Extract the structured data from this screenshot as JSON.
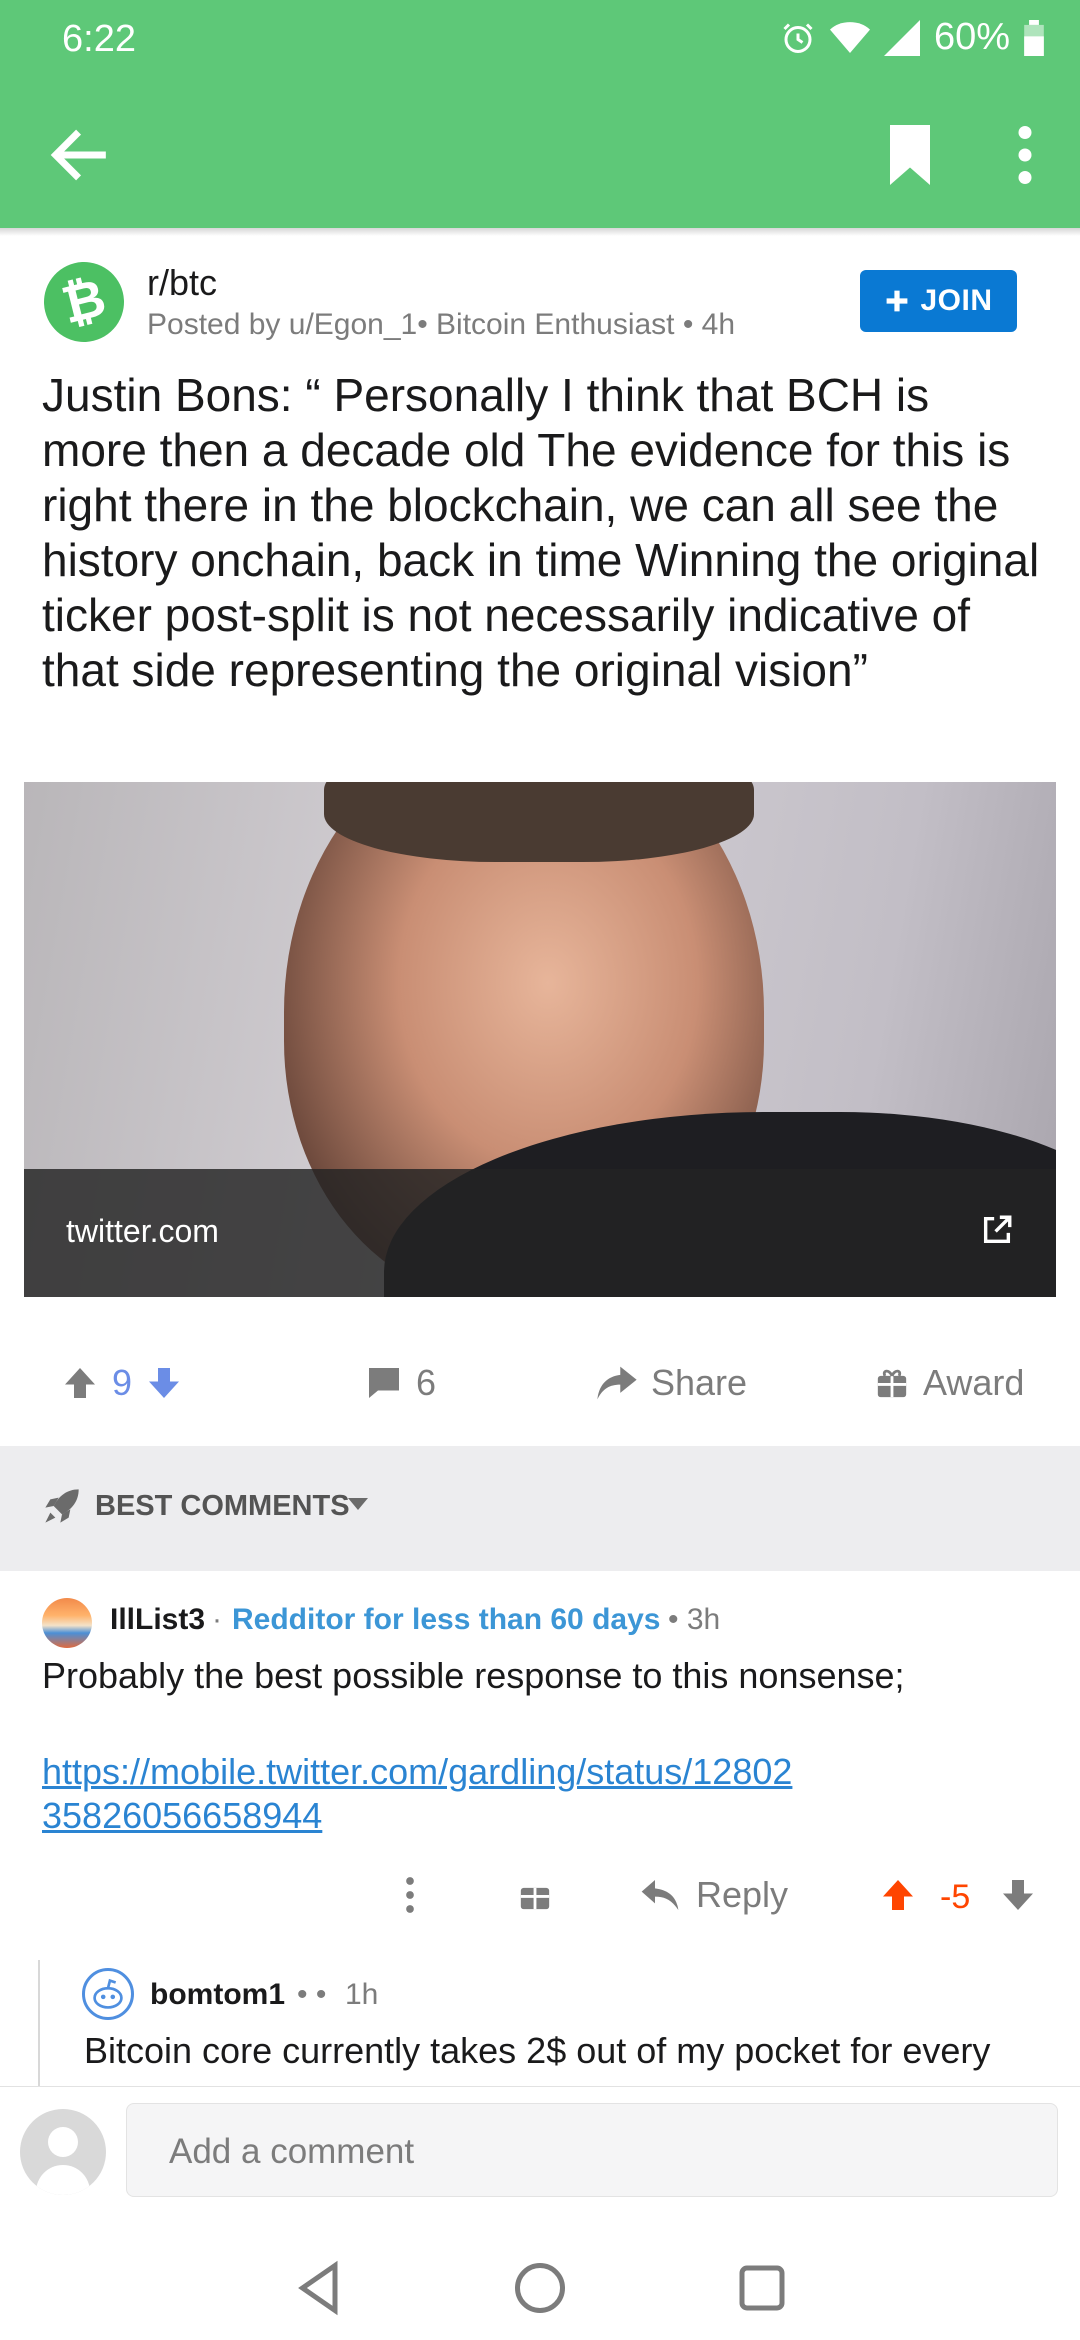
{
  "status_bar": {
    "time": "6:22",
    "battery": "60%"
  },
  "app_bar": {
    "back_icon": "arrow-left-icon",
    "bookmark_icon": "bookmark-icon",
    "more_icon": "more-vert-icon"
  },
  "post": {
    "subreddit": "r/btc",
    "meta": "Posted by u/Egon_1• Bitcoin Enthusiast • 4h",
    "join_label": "JOIN",
    "title": "Justin Bons: “ Personally I think that BCH is more then a decade old The evidence for this is right there in the blockchain, we can all see the history onchain, back in time Winning the original ticker post-split is not necessarily indicative of that side representing the original vision”",
    "link_domain": "twitter.com",
    "vote_count": "9",
    "comment_count": "6",
    "share_label": "Share",
    "award_label": "Award"
  },
  "comments_header": {
    "sort_label": "BEST COMMENTS"
  },
  "comments": [
    {
      "user": "IllList3",
      "flair": "Redditor for less than 60 days",
      "time": "3h",
      "body": "Probably the best possible response to this nonsense;",
      "link": "https://mobile.twitter.com/gardling/status/1280235826056658944",
      "reply_label": "Reply",
      "score": "-5"
    },
    {
      "user": "bomtom1",
      "separator": "•  •",
      "time": "1h",
      "body": "Bitcoin core currently takes 2$ out of my pocket for every"
    }
  ],
  "composer": {
    "placeholder": "Add a comment"
  },
  "colors": {
    "brand_green": "#5ec878",
    "join_blue": "#0a79d3",
    "upvote": "#ff4500",
    "link": "#2a84d2",
    "flair": "#3c96d6"
  }
}
